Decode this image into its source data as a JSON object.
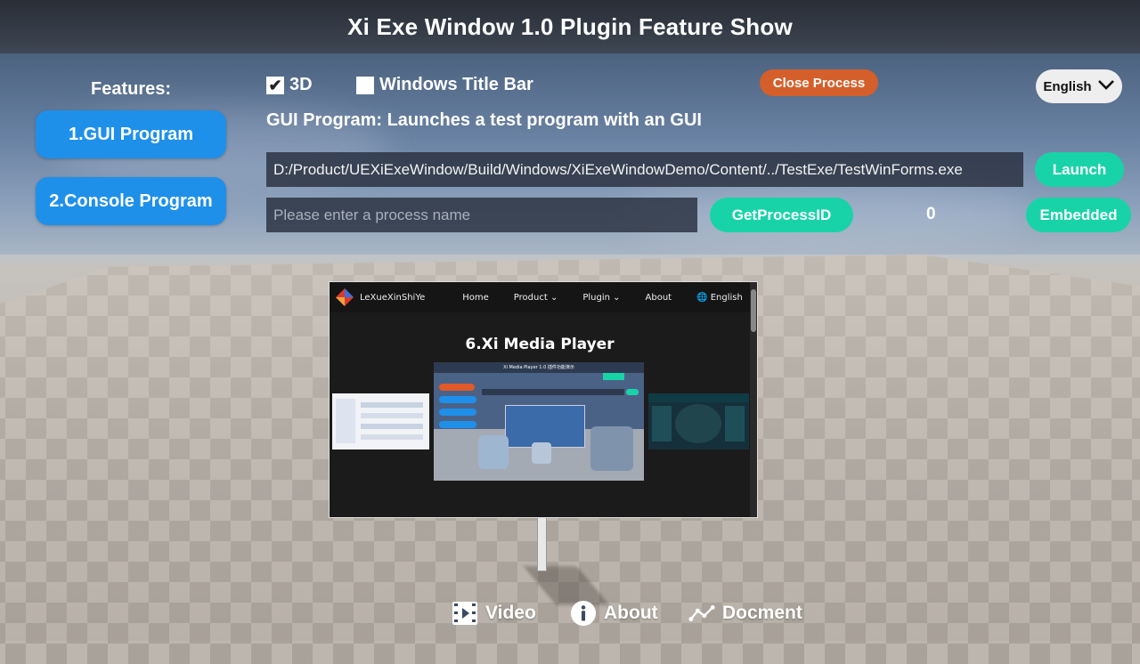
{
  "title": "Xi Exe Window 1.0 Plugin  Feature Show",
  "sidebar": {
    "label": "Features:",
    "items": [
      {
        "label": "1.GUI Program"
      },
      {
        "label": "2.Console Program"
      }
    ]
  },
  "options": {
    "checkbox_3d": {
      "label": "3D",
      "checked": true
    },
    "checkbox_titlebar": {
      "label": "Windows Title Bar",
      "checked": false
    }
  },
  "close_process_label": "Close Process",
  "language": {
    "selected": "English"
  },
  "description": "GUI Program: Launches a test program with an GUI",
  "exe_path": "D:/Product/UEXiExeWindow/Build/Windows/XiExeWindowDemo/Content/../TestExe/TestWinForms.exe",
  "launch_label": "Launch",
  "process_name": {
    "value": "",
    "placeholder": "Please enter a process name"
  },
  "get_pid_label": "GetProcessID",
  "pid_value": "0",
  "embedded_label": "Embedded",
  "embedded_window": {
    "brand": "LeXueXinShiYe",
    "nav": [
      "Home",
      "Product",
      "Plugin",
      "About",
      "English"
    ],
    "heading": "6.Xi Media Player",
    "slide_title": "Xi Media Player 1.0 插件功能演示"
  },
  "bottom_links": [
    {
      "label": "Video",
      "icon": "video-icon"
    },
    {
      "label": "About",
      "icon": "info-icon"
    },
    {
      "label": "Docment",
      "icon": "chart-line-icon"
    }
  ],
  "colors": {
    "primary_blue": "#1e90ea",
    "teal": "#19d3a8",
    "close_orange": "#d45f2a"
  }
}
